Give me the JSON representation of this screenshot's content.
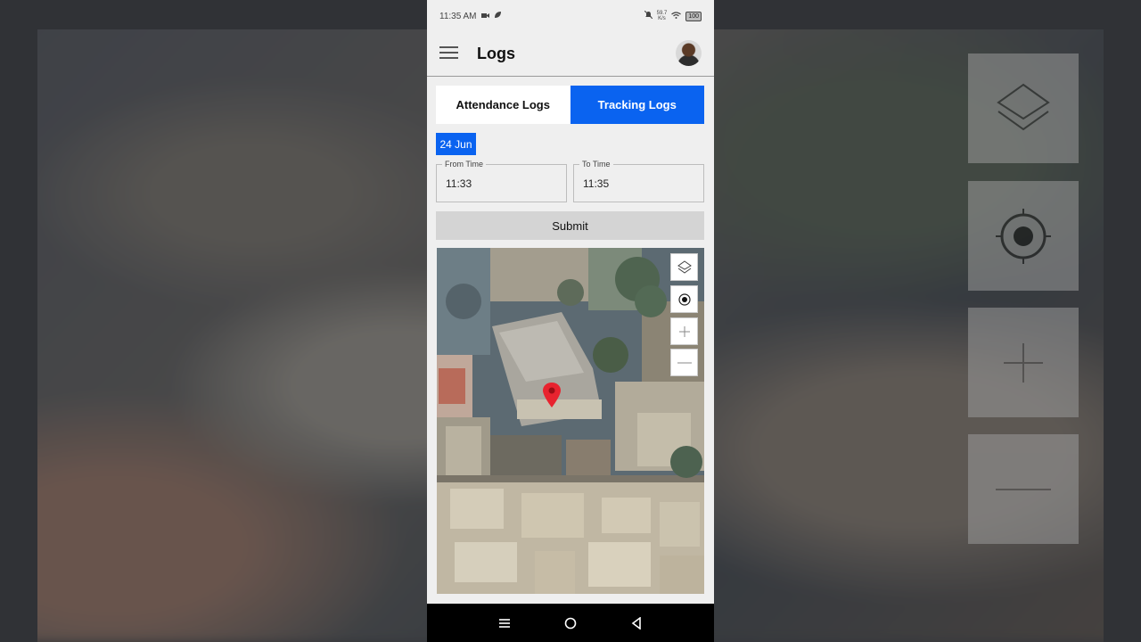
{
  "status_bar": {
    "time": "11:35 AM",
    "speed_value": "59.7",
    "speed_unit": "K/s",
    "battery": "100"
  },
  "app_bar": {
    "title": "Logs"
  },
  "tabs": [
    {
      "label": "Attendance Logs",
      "active": false
    },
    {
      "label": "Tracking Logs",
      "active": true
    }
  ],
  "date_chip": "24 Jun",
  "from_time": {
    "label": "From Time",
    "value": "11:33"
  },
  "to_time": {
    "label": "To Time",
    "value": "11:35"
  },
  "submit_label": "Submit",
  "map": {
    "controls": [
      "layers-icon",
      "my-location-icon",
      "zoom-in-icon",
      "zoom-out-icon"
    ],
    "marker_color": "#e8232f"
  },
  "colors": {
    "accent": "#0a63f0",
    "background": "#efefef"
  }
}
